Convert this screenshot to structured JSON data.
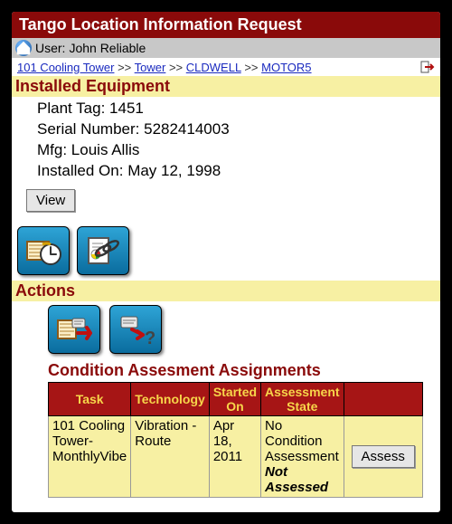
{
  "titlebar": "Tango Location Information Request",
  "user": {
    "label": "User:",
    "name": "John Reliable"
  },
  "breadcrumb": {
    "items": [
      "101 Cooling Tower",
      "Tower",
      "CLDWELL",
      "MOTOR5"
    ],
    "sep": ">>"
  },
  "installed": {
    "heading": "Installed Equipment",
    "plant_tag_label": "Plant Tag:",
    "plant_tag": "1451",
    "serial_label": "Serial Number:",
    "serial": "5282414003",
    "mfg_label": "Mfg:",
    "mfg": "Louis Allis",
    "installed_on_label": "Installed On:",
    "installed_on": "May 12, 1998",
    "view_label": "View"
  },
  "actions": {
    "heading": "Actions",
    "subhead": "Condition Assesment Assignments",
    "cols": [
      "Task",
      "Technology",
      "Started On",
      "Assessment State",
      ""
    ],
    "rows": [
      {
        "task": "101 Cooling Tower-MonthlyVibe",
        "tech": "Vibration - Route",
        "started": "Apr 18, 2011",
        "state_line1": "No Condition Assessment",
        "state_line2": "Not Assessed",
        "assess_label": "Assess"
      }
    ]
  }
}
